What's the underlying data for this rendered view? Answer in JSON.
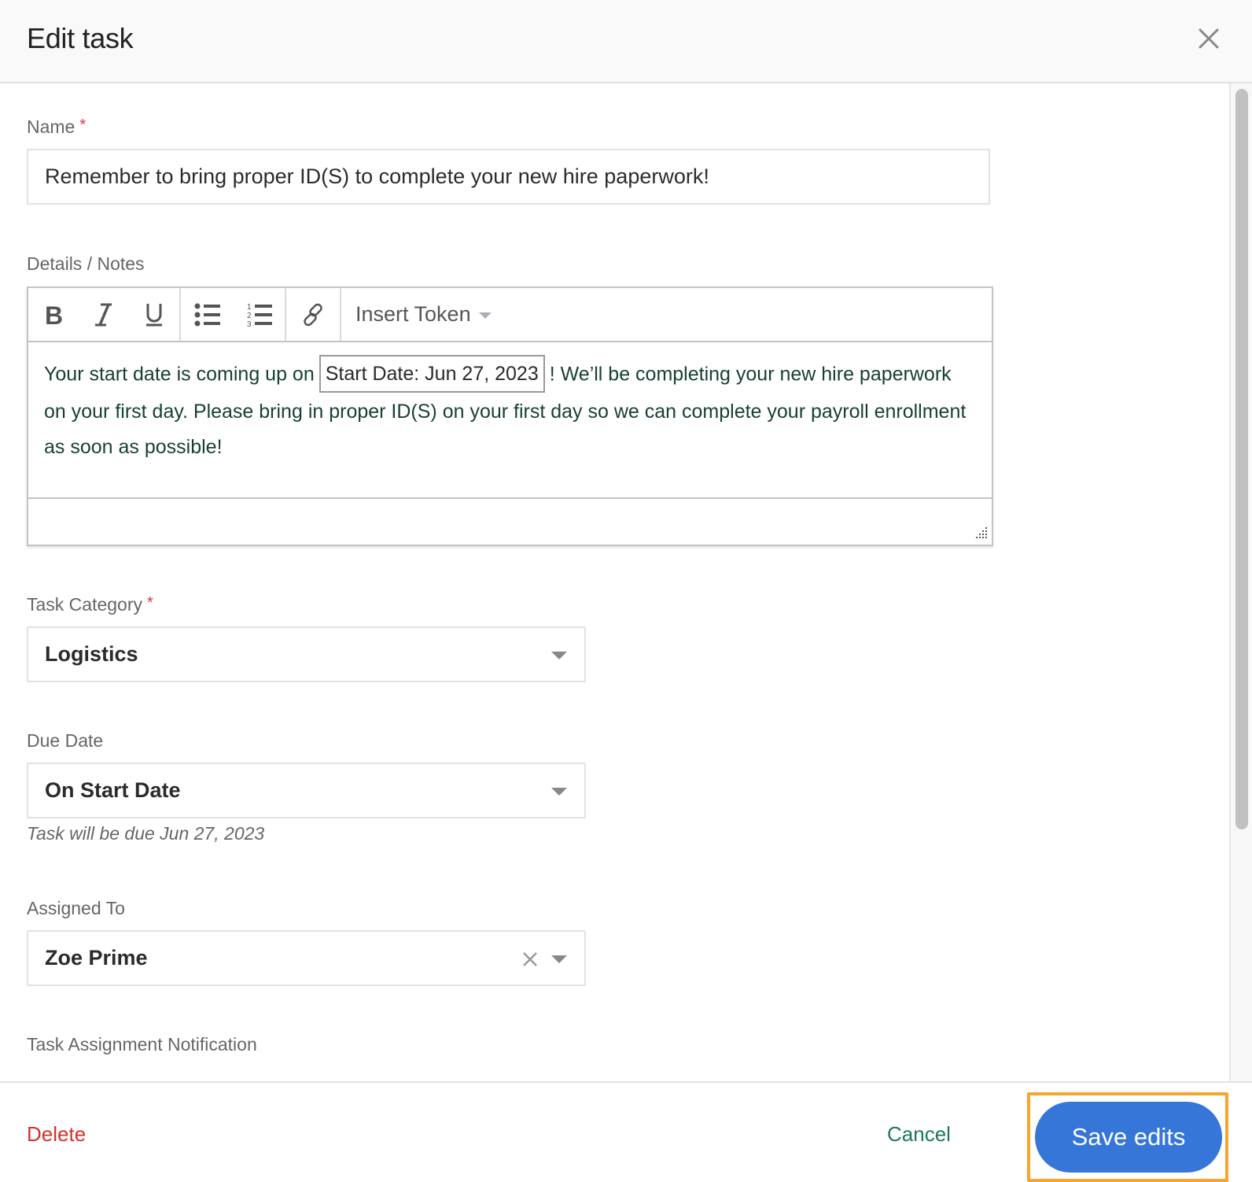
{
  "header": {
    "title": "Edit task",
    "close_icon": "close-icon"
  },
  "form": {
    "name": {
      "label": "Name",
      "required_mark": "*",
      "value": "Remember to bring proper ID(S) to complete your new hire paperwork!"
    },
    "details": {
      "label": "Details / Notes",
      "toolbar": {
        "buttons": [
          {
            "name": "bold",
            "icon": "bold-icon"
          },
          {
            "name": "italic",
            "icon": "italic-icon"
          },
          {
            "name": "underline",
            "icon": "underline-icon"
          },
          {
            "name": "bulleted-list",
            "icon": "bulleted-list-icon"
          },
          {
            "name": "numbered-list",
            "icon": "numbered-list-icon"
          },
          {
            "name": "link",
            "icon": "link-icon"
          }
        ],
        "insert_token_label": "Insert Token"
      },
      "body_before_token": "Your start date is coming up on",
      "token": "Start Date: Jun 27, 2023",
      "body_after_token": "! We’ll be completing your new hire paperwork on your first day. Please bring in proper ID(S) on your first day so we can complete your payroll enrollment as soon as possible!"
    },
    "task_category": {
      "label": "Task Category",
      "required_mark": "*",
      "value": "Logistics"
    },
    "due_date": {
      "label": "Due Date",
      "value": "On Start Date",
      "hint": "Task will be due Jun 27, 2023"
    },
    "assigned_to": {
      "label": "Assigned To",
      "value": "Zoe Prime"
    },
    "task_assignment_notification": {
      "label": "Task Assignment Notification"
    }
  },
  "footer": {
    "delete_label": "Delete",
    "cancel_label": "Cancel",
    "save_label": "Save edits"
  },
  "colors": {
    "primary": "#3576d8",
    "danger": "#d5302a",
    "cancel": "#1b7a55",
    "required": "#d9324b",
    "highlight": "#f7a52b"
  }
}
